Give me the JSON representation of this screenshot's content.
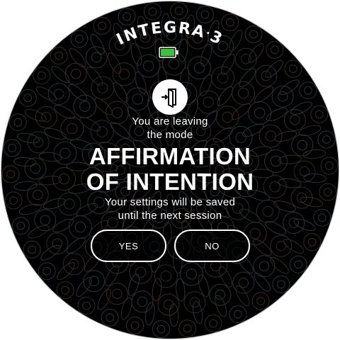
{
  "device": {
    "brand_name": "INTEGRA",
    "brand_dot": "·",
    "brand_version": "3"
  },
  "icons": {
    "battery": "battery-full-icon",
    "exit": "exit-door-icon"
  },
  "battery": {
    "level": 1.0,
    "color": "#39c53f"
  },
  "dialog": {
    "intro_line1": "You are leaving",
    "intro_line2": "the mode",
    "mode_line1": "AFFIRMATION",
    "mode_line2": "OF INTENTION",
    "note_line1": "Your settings will be saved",
    "note_line2": "until the next session"
  },
  "buttons": {
    "yes_label": "YES",
    "no_label": "NO"
  }
}
